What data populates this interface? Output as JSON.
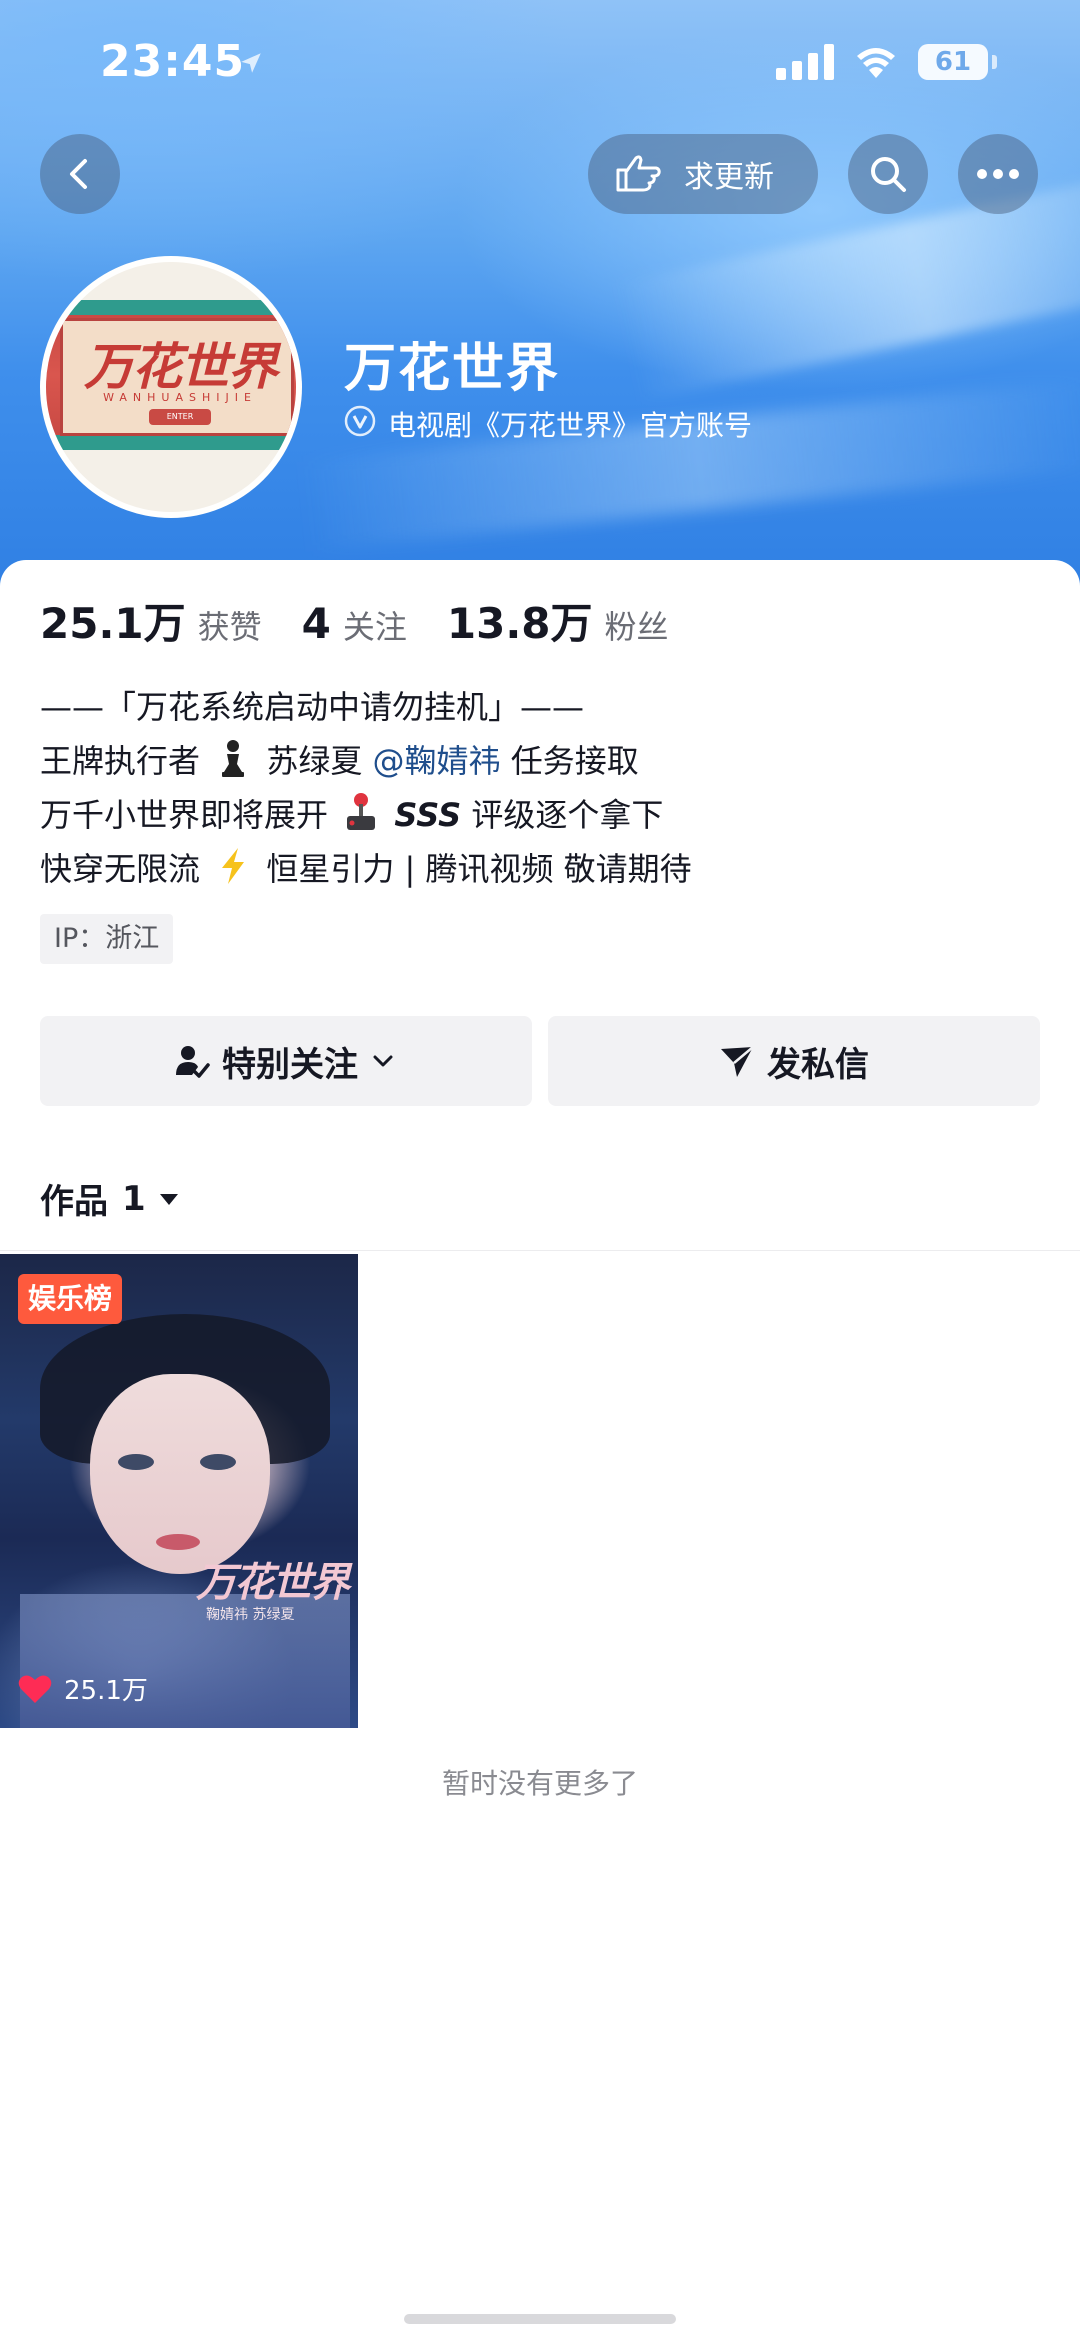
{
  "status_bar": {
    "time": "23:45",
    "battery": "61"
  },
  "nav": {
    "update_label": "求更新"
  },
  "profile": {
    "avatar_title": "万花世界",
    "avatar_subtitle": "WANHUASHIJIE",
    "avatar_enter": "ENTER",
    "name": "万花世界",
    "verified_text": "电视剧《万花世界》官方账号"
  },
  "stats": {
    "likes_value": "25.1万",
    "likes_label": "获赞",
    "following_value": "4",
    "following_label": "关注",
    "followers_value": "13.8万",
    "followers_label": "粉丝"
  },
  "bio": {
    "line1": "——「万花系统启动中请勿挂机」——",
    "line2_prefix": "王牌执行者",
    "line2_name": "苏绿夏",
    "line2_mention": "@鞠婧祎",
    "line2_suffix": "任务接取",
    "line3_prefix": "万千小世界即将展开",
    "line3_sss": "SSS",
    "line3_suffix": "评级逐个拿下",
    "line4_prefix": "快穿无限流",
    "line4_suffix": "恒星引力 | 腾讯视频 敬请期待"
  },
  "ip_location": "IP：浙江",
  "actions": {
    "follow_label": "特别关注",
    "message_label": "发私信"
  },
  "works": {
    "tab_label": "作品",
    "count": "1",
    "items": [
      {
        "badge": "娱乐榜",
        "title_art": "万花世界",
        "credits": "鞠婧祎 苏绿夏",
        "likes": "25.1万"
      }
    ]
  },
  "end_text": "暂时没有更多了",
  "colors": {
    "accent_red": "#fe5a3d",
    "mention_blue": "#1f4e8c",
    "header_blue": "#3f8fec"
  },
  "icons": [
    "back-icon",
    "hand-point-icon",
    "search-icon",
    "more-icon",
    "verified-icon",
    "chess-pawn-icon",
    "joystick-icon",
    "lightning-icon",
    "follow-user-icon",
    "chevron-down-icon",
    "send-icon",
    "caret-down-icon",
    "heart-icon"
  ]
}
